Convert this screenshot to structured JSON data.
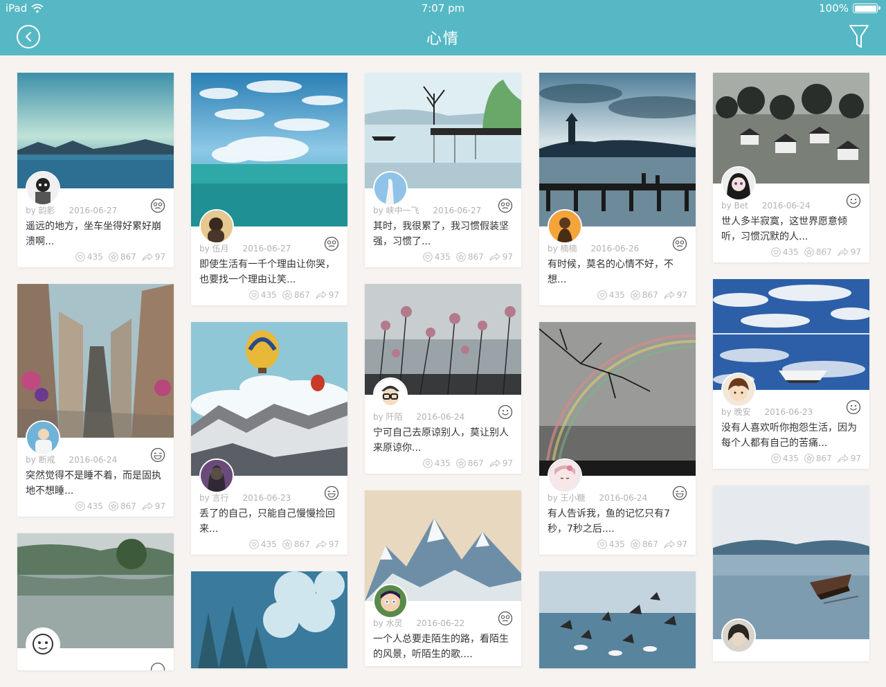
{
  "status_bar": {
    "device": "iPad",
    "time": "7:07 pm",
    "battery": "100%"
  },
  "header": {
    "title": "心情"
  },
  "stats_labels": {
    "likes": "435",
    "favorites": "867",
    "shares": "97"
  },
  "columns": [
    [
      {
        "author": "by 韵影",
        "date": "2016-06-27",
        "desc": "遥远的地方，坐车坐得好累好崩溃啊...",
        "likes": "435",
        "favs": "867",
        "shares": "97",
        "mood": "dizzy"
      },
      {
        "author": "by 断戒",
        "date": "2016-06-24",
        "desc": "突然觉得不是睡不着，而是固执地不想睡...",
        "likes": "435",
        "favs": "867",
        "shares": "97",
        "mood": "laugh"
      },
      {
        "author": "",
        "date": "",
        "desc": "",
        "likes": "",
        "favs": "",
        "shares": "",
        "mood": "smile"
      }
    ],
    [
      {
        "author": "by 伍月",
        "date": "2016-06-27",
        "desc": "即使生活有一千个理由让你哭，也要找一个理由让笑...",
        "likes": "435",
        "favs": "867",
        "shares": "97",
        "mood": "dizzy"
      },
      {
        "author": "by 言行",
        "date": "2016-06-23",
        "desc": "丢了的自己，只能自己慢慢捡回来...",
        "likes": "435",
        "favs": "867",
        "shares": "97",
        "mood": "laugh"
      }
    ],
    [
      {
        "author": "by 峡中一飞",
        "date": "2016-06-27",
        "desc": "其时，我很累了，我习惯假装坚强，习惯了...",
        "likes": "435",
        "favs": "867",
        "shares": "97",
        "mood": "dizzy"
      },
      {
        "author": "by 阡陌",
        "date": "2016-06-24",
        "desc": "宁可自己去原谅别人，莫让别人来原谅你...",
        "likes": "435",
        "favs": "867",
        "shares": "97",
        "mood": "smile"
      },
      {
        "author": "by 水灵",
        "date": "2016-06-22",
        "desc": "一个人总要走陌生的路，看陌生的风景，听陌生的歌....",
        "likes": "",
        "favs": "",
        "shares": "",
        "mood": "dizzy"
      }
    ],
    [
      {
        "author": "by 楠楠",
        "date": "2016-06-26",
        "desc": "有时候，莫名的心情不好，不想...",
        "likes": "435",
        "favs": "867",
        "shares": "97",
        "mood": "dizzy"
      },
      {
        "author": "by 王小糖",
        "date": "2016-06-24",
        "desc": "有人告诉我，鱼的记忆只有7秒，7秒之后....",
        "likes": "435",
        "favs": "867",
        "shares": "97",
        "mood": "laugh"
      }
    ],
    [
      {
        "author": "by Bet",
        "date": "2016-06-24",
        "desc": "世人多半寂寞，这世界愿意倾听，习惯沉默的人...",
        "likes": "435",
        "favs": "867",
        "shares": "97",
        "mood": "smile"
      },
      {
        "author": "by 晚安",
        "date": "2016-06-23",
        "desc": "没有人喜欢听你抱怨生活，因为每个人都有自己的苦痛...",
        "likes": "435",
        "favs": "867",
        "shares": "97",
        "mood": "smile"
      },
      {
        "author": "",
        "date": "",
        "desc": "",
        "likes": "",
        "favs": "",
        "shares": "",
        "mood": "smile"
      }
    ]
  ],
  "colors": {
    "header": "#57b8c5",
    "background": "#f6f3f1",
    "text": "#333333",
    "meta": "#b2b2b2"
  }
}
